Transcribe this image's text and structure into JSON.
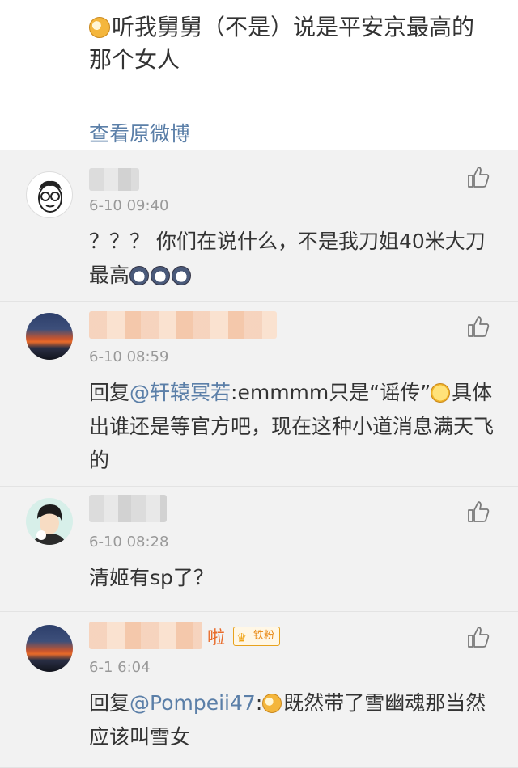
{
  "post": {
    "text": "听我舅舅（不是）说是平安京最高的那个女人",
    "view_original": "查看原微博"
  },
  "comments": [
    {
      "time": "6-10 09:40",
      "text": "？？？ 你们在说什么，不是我刀姐40米大刀最高"
    },
    {
      "time": "6-10 08:59",
      "reply_prefix": "回复",
      "mention": "@轩辕冥若",
      "text": ":emmmm只是“谣传”",
      "text_after": "具体出谁还是等官方吧，现在这种小道消息满天飞的"
    },
    {
      "time": "6-10 08:28",
      "text": "清姬有sp了？"
    },
    {
      "name_tail": "啦",
      "badge": "铁粉",
      "time": "6-1  6:04",
      "reply_prefix": "回复",
      "mention": "@Pompeii47",
      "text_pre": ":",
      "text": "既然带了雪幽魂那当然应该叫雪女"
    }
  ],
  "icons": [
    "doge-emoji",
    "thumbs-up-icon",
    "panda-emoji",
    "nerd-emoji",
    "crown-icon"
  ]
}
